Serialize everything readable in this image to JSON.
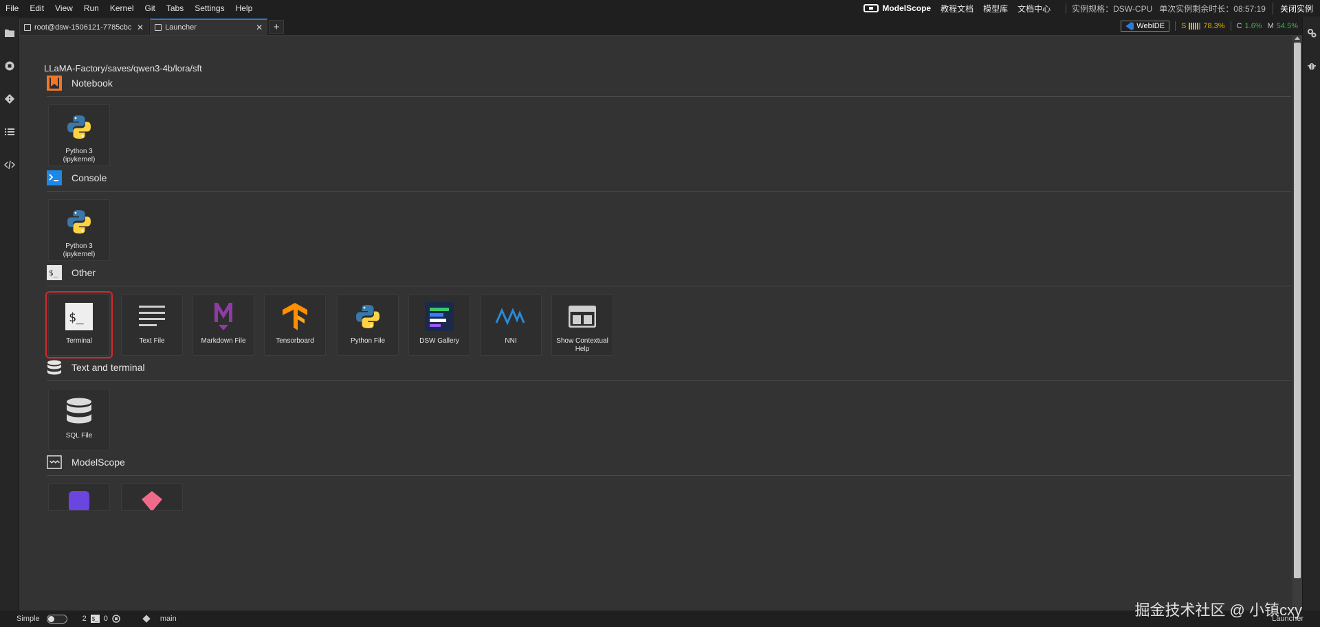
{
  "menu": [
    "File",
    "Edit",
    "View",
    "Run",
    "Kernel",
    "Git",
    "Tabs",
    "Settings",
    "Help"
  ],
  "top_right": {
    "brand": "ModelScope",
    "links": [
      "教程文档",
      "模型库",
      "文档中心"
    ],
    "instance_spec": "实例规格：DSW-CPU",
    "remaining_time": "单次实例剩余时长：08:57:19",
    "close_instance": "关闭实例"
  },
  "tabs": [
    {
      "label": "root@dsw-1506121-7785cbc",
      "active": false
    },
    {
      "label": "Launcher",
      "active": true
    }
  ],
  "tab_add": "+",
  "status_widgets": {
    "webide": "WebIDE",
    "s_label": "S",
    "s_value": "78.3%",
    "c_label": "C",
    "c_value": "1.6%",
    "m_label": "M",
    "m_value": "54.5%"
  },
  "launcher": {
    "path": "LLaMA-Factory/saves/qwen3-4b/lora/sft",
    "sections": {
      "notebook": {
        "title": "Notebook",
        "cards": [
          {
            "label": "Python 3 (ipykernel)"
          }
        ]
      },
      "console": {
        "title": "Console",
        "cards": [
          {
            "label": "Python 3 (ipykernel)"
          }
        ]
      },
      "other": {
        "title": "Other",
        "cards": [
          {
            "label": "Terminal"
          },
          {
            "label": "Text File"
          },
          {
            "label": "Markdown File"
          },
          {
            "label": "Tensorboard"
          },
          {
            "label": "Python File"
          },
          {
            "label": "DSW Gallery"
          },
          {
            "label": "NNI"
          },
          {
            "label": "Show Contextual Help"
          }
        ]
      },
      "text_terminal": {
        "title": "Text and terminal",
        "cards": [
          {
            "label": "SQL File"
          }
        ]
      },
      "modelscope": {
        "title": "ModelScope"
      }
    }
  },
  "statusbar": {
    "mode": "Simple",
    "terminals": "2",
    "kernels": "0",
    "branch": "main",
    "right_label": "Launcher"
  },
  "watermark": "掘金技术社区 @ 小镇cxy",
  "colors": {
    "accent": "#2b7bd6",
    "highlight": "#d6282a",
    "s_metric": "#e0b000",
    "c_metric": "#3bb34a"
  }
}
